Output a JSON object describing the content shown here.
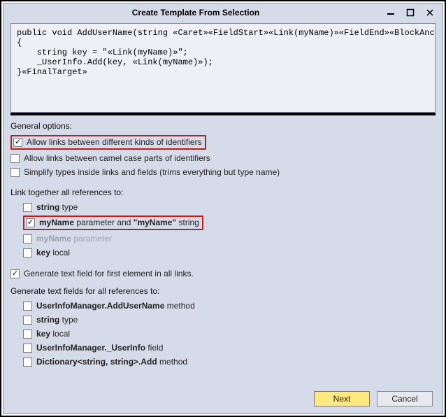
{
  "window": {
    "title": "Create Template From Selection"
  },
  "code": {
    "l1": "public void AddUserName(string «Caret»«FieldStart»«Link(myName)»«FieldEnd»«BlockAnchor»)",
    "l2": "{",
    "l3": "    string key = \"«Link(myName)»\";",
    "l4": "    _UserInfo.Add(key, «Link(myName)»);",
    "l5": "}«FinalTarget»"
  },
  "general": {
    "label": "General options:",
    "allowKinds": "Allow links between different kinds of identifiers",
    "allowCamel": "Allow links between camel case parts of identifiers",
    "simplify": "Simplify types inside links and fields (trims everything but type name)"
  },
  "link": {
    "label": "Link together all references to:",
    "stringType_b": "string",
    "stringType_t": " type",
    "myNameParam_b1": "myName",
    "myNameParam_t1": " parameter and ",
    "myNameParam_b2": "\"myName\"",
    "myNameParam_t2": " string",
    "myNameDisabled_b": "myName",
    "myNameDisabled_t": " parameter",
    "keyLocal_b": "key",
    "keyLocal_t": " local"
  },
  "genFirst": "Generate text field for first element in all links.",
  "genFields": {
    "label": "Generate text fields for all references to:",
    "i1_b": "UserInfoManager.AddUserName",
    "i1_t": " method",
    "i2_b": "string",
    "i2_t": " type",
    "i3_b": "key",
    "i3_t": " local",
    "i4_b": "UserInfoManager._UserInfo",
    "i4_t": " field",
    "i5_b": "Dictionary<string, string>.Add",
    "i5_t": " method"
  },
  "buttons": {
    "next": "Next",
    "cancel": "Cancel"
  }
}
